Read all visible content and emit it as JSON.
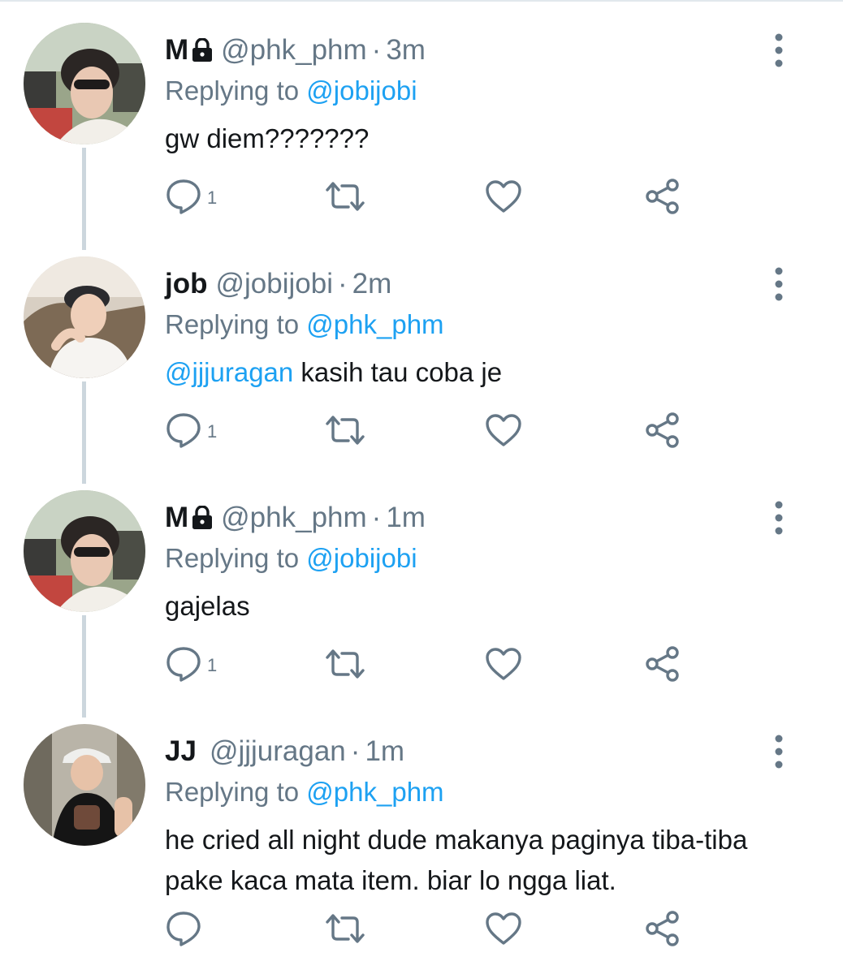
{
  "tweets": [
    {
      "name": "M",
      "locked": true,
      "handle": "@phk_phm",
      "time": "3m",
      "replying_label": "Replying to",
      "replying_to": "@jobijobi",
      "mention": "",
      "text": "gw diem???????",
      "reply_count": "1"
    },
    {
      "name": "job",
      "locked": false,
      "handle": "@jobijobi",
      "time": "2m",
      "replying_label": "Replying to",
      "replying_to": "@phk_phm",
      "mention": "@jjjuragan",
      "text": " kasih tau coba je",
      "reply_count": "1"
    },
    {
      "name": "M",
      "locked": true,
      "handle": "@phk_phm",
      "time": "1m",
      "replying_label": "Replying to",
      "replying_to": "@jobijobi",
      "mention": "",
      "text": "gajelas",
      "reply_count": "1"
    },
    {
      "name": "JJ",
      "locked": false,
      "handle": "@jjjuragan",
      "time": "1m",
      "replying_label": "Replying to",
      "replying_to": "@phk_phm",
      "mention": "",
      "text": "he cried all night dude makanya paginya tiba-tiba pake kaca mata item. biar lo ngga liat.",
      "reply_count": ""
    }
  ],
  "separator": "·",
  "colors": {
    "accent": "#1da1f2",
    "secondary": "#657786",
    "thread_line": "#ccd6dd"
  },
  "icons": [
    "lock-icon",
    "more-vertical-icon",
    "reply-icon",
    "retweet-icon",
    "like-icon",
    "share-icon"
  ]
}
